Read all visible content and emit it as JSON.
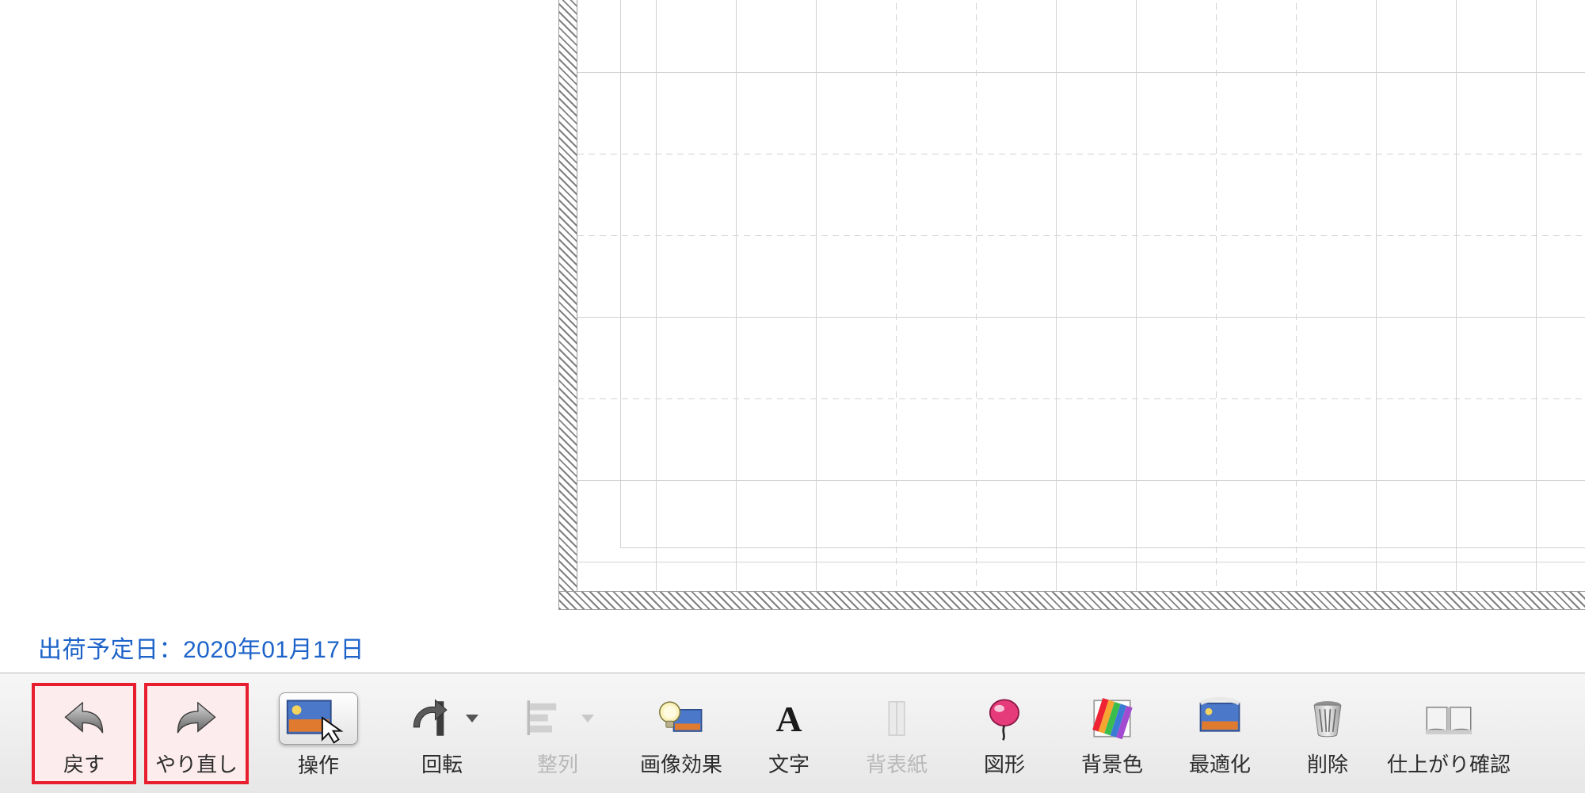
{
  "ship_date_label": "出荷予定日：2020年01月17日",
  "toolbar": {
    "undo": {
      "label": "戻す",
      "icon": "undo-arrow-icon",
      "highlight": true
    },
    "redo": {
      "label": "やり直し",
      "icon": "redo-arrow-icon",
      "highlight": true
    },
    "operate": {
      "label": "操作",
      "icon": "image-cursor-icon"
    },
    "rotate": {
      "label": "回転",
      "icon": "rotate-icon",
      "dropdown": true
    },
    "align": {
      "label": "整列",
      "icon": "align-icon",
      "dropdown": true,
      "disabled": true
    },
    "image_effect": {
      "label": "画像効果",
      "icon": "lightbulb-image-icon"
    },
    "text": {
      "label": "文字",
      "icon": "letter-a-icon"
    },
    "spine": {
      "label": "背表紙",
      "icon": "spine-icon",
      "disabled": true
    },
    "shape": {
      "label": "図形",
      "icon": "balloon-shape-icon"
    },
    "bgcolor": {
      "label": "背景色",
      "icon": "rainbow-swatch-icon"
    },
    "optimize": {
      "label": "最適化",
      "icon": "optimize-image-icon"
    },
    "delete": {
      "label": "削除",
      "icon": "trash-icon"
    },
    "preview": {
      "label": "仕上がり確認",
      "icon": "open-book-icon"
    }
  }
}
